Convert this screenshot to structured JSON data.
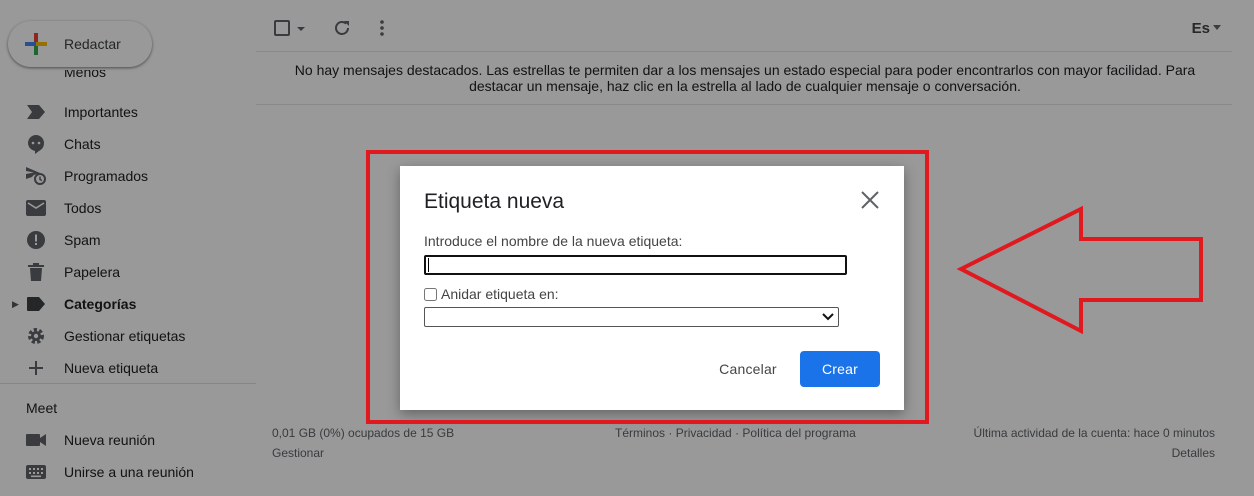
{
  "sidebar": {
    "compose_label": "Redactar",
    "cut_item_label": "Menos",
    "items": [
      {
        "label": "Importantes",
        "icon": "label-important-icon"
      },
      {
        "label": "Chats",
        "icon": "chat-icon"
      },
      {
        "label": "Programados",
        "icon": "scheduled-send-icon"
      },
      {
        "label": "Todos",
        "icon": "all-mail-icon"
      },
      {
        "label": "Spam",
        "icon": "spam-icon"
      },
      {
        "label": "Papelera",
        "icon": "trash-icon"
      },
      {
        "label": "Categorías",
        "icon": "category-label-icon"
      },
      {
        "label": "Gestionar etiquetas",
        "icon": "gear-icon"
      },
      {
        "label": "Nueva etiqueta",
        "icon": "plus-icon"
      }
    ],
    "meet": {
      "title": "Meet",
      "items": [
        {
          "label": "Nueva reunión",
          "icon": "video-camera-icon"
        },
        {
          "label": "Unirse a una reunión",
          "icon": "keyboard-icon"
        }
      ]
    }
  },
  "toolbar": {
    "language": "Es"
  },
  "main": {
    "empty_message": "No hay mensajes destacados. Las estrellas te permiten dar a los mensajes un estado especial para poder encontrarlos con mayor facilidad. Para destacar un mensaje, haz clic en la estrella al lado de cualquier mensaje o conversación."
  },
  "footer": {
    "storage": "0,01 GB (0%) ocupados de 15 GB",
    "manage": "Gestionar",
    "terms": "Términos",
    "privacy": "Privacidad",
    "policy": "Política del programa",
    "separator": "·",
    "last_activity": "Última actividad de la cuenta: hace 0 minutos",
    "details": "Detalles"
  },
  "dialog": {
    "title": "Etiqueta nueva",
    "name_label": "Introduce el nombre de la nueva etiqueta:",
    "name_value": "",
    "nest_label": "Anidar etiqueta en:",
    "nest_checked": false,
    "parent_selected": "",
    "cancel_label": "Cancelar",
    "create_label": "Crear"
  },
  "colors": {
    "annotation_red": "#e0191f",
    "primary_blue": "#1a73e8",
    "overlay": "rgba(0,0,0,0.4)"
  }
}
